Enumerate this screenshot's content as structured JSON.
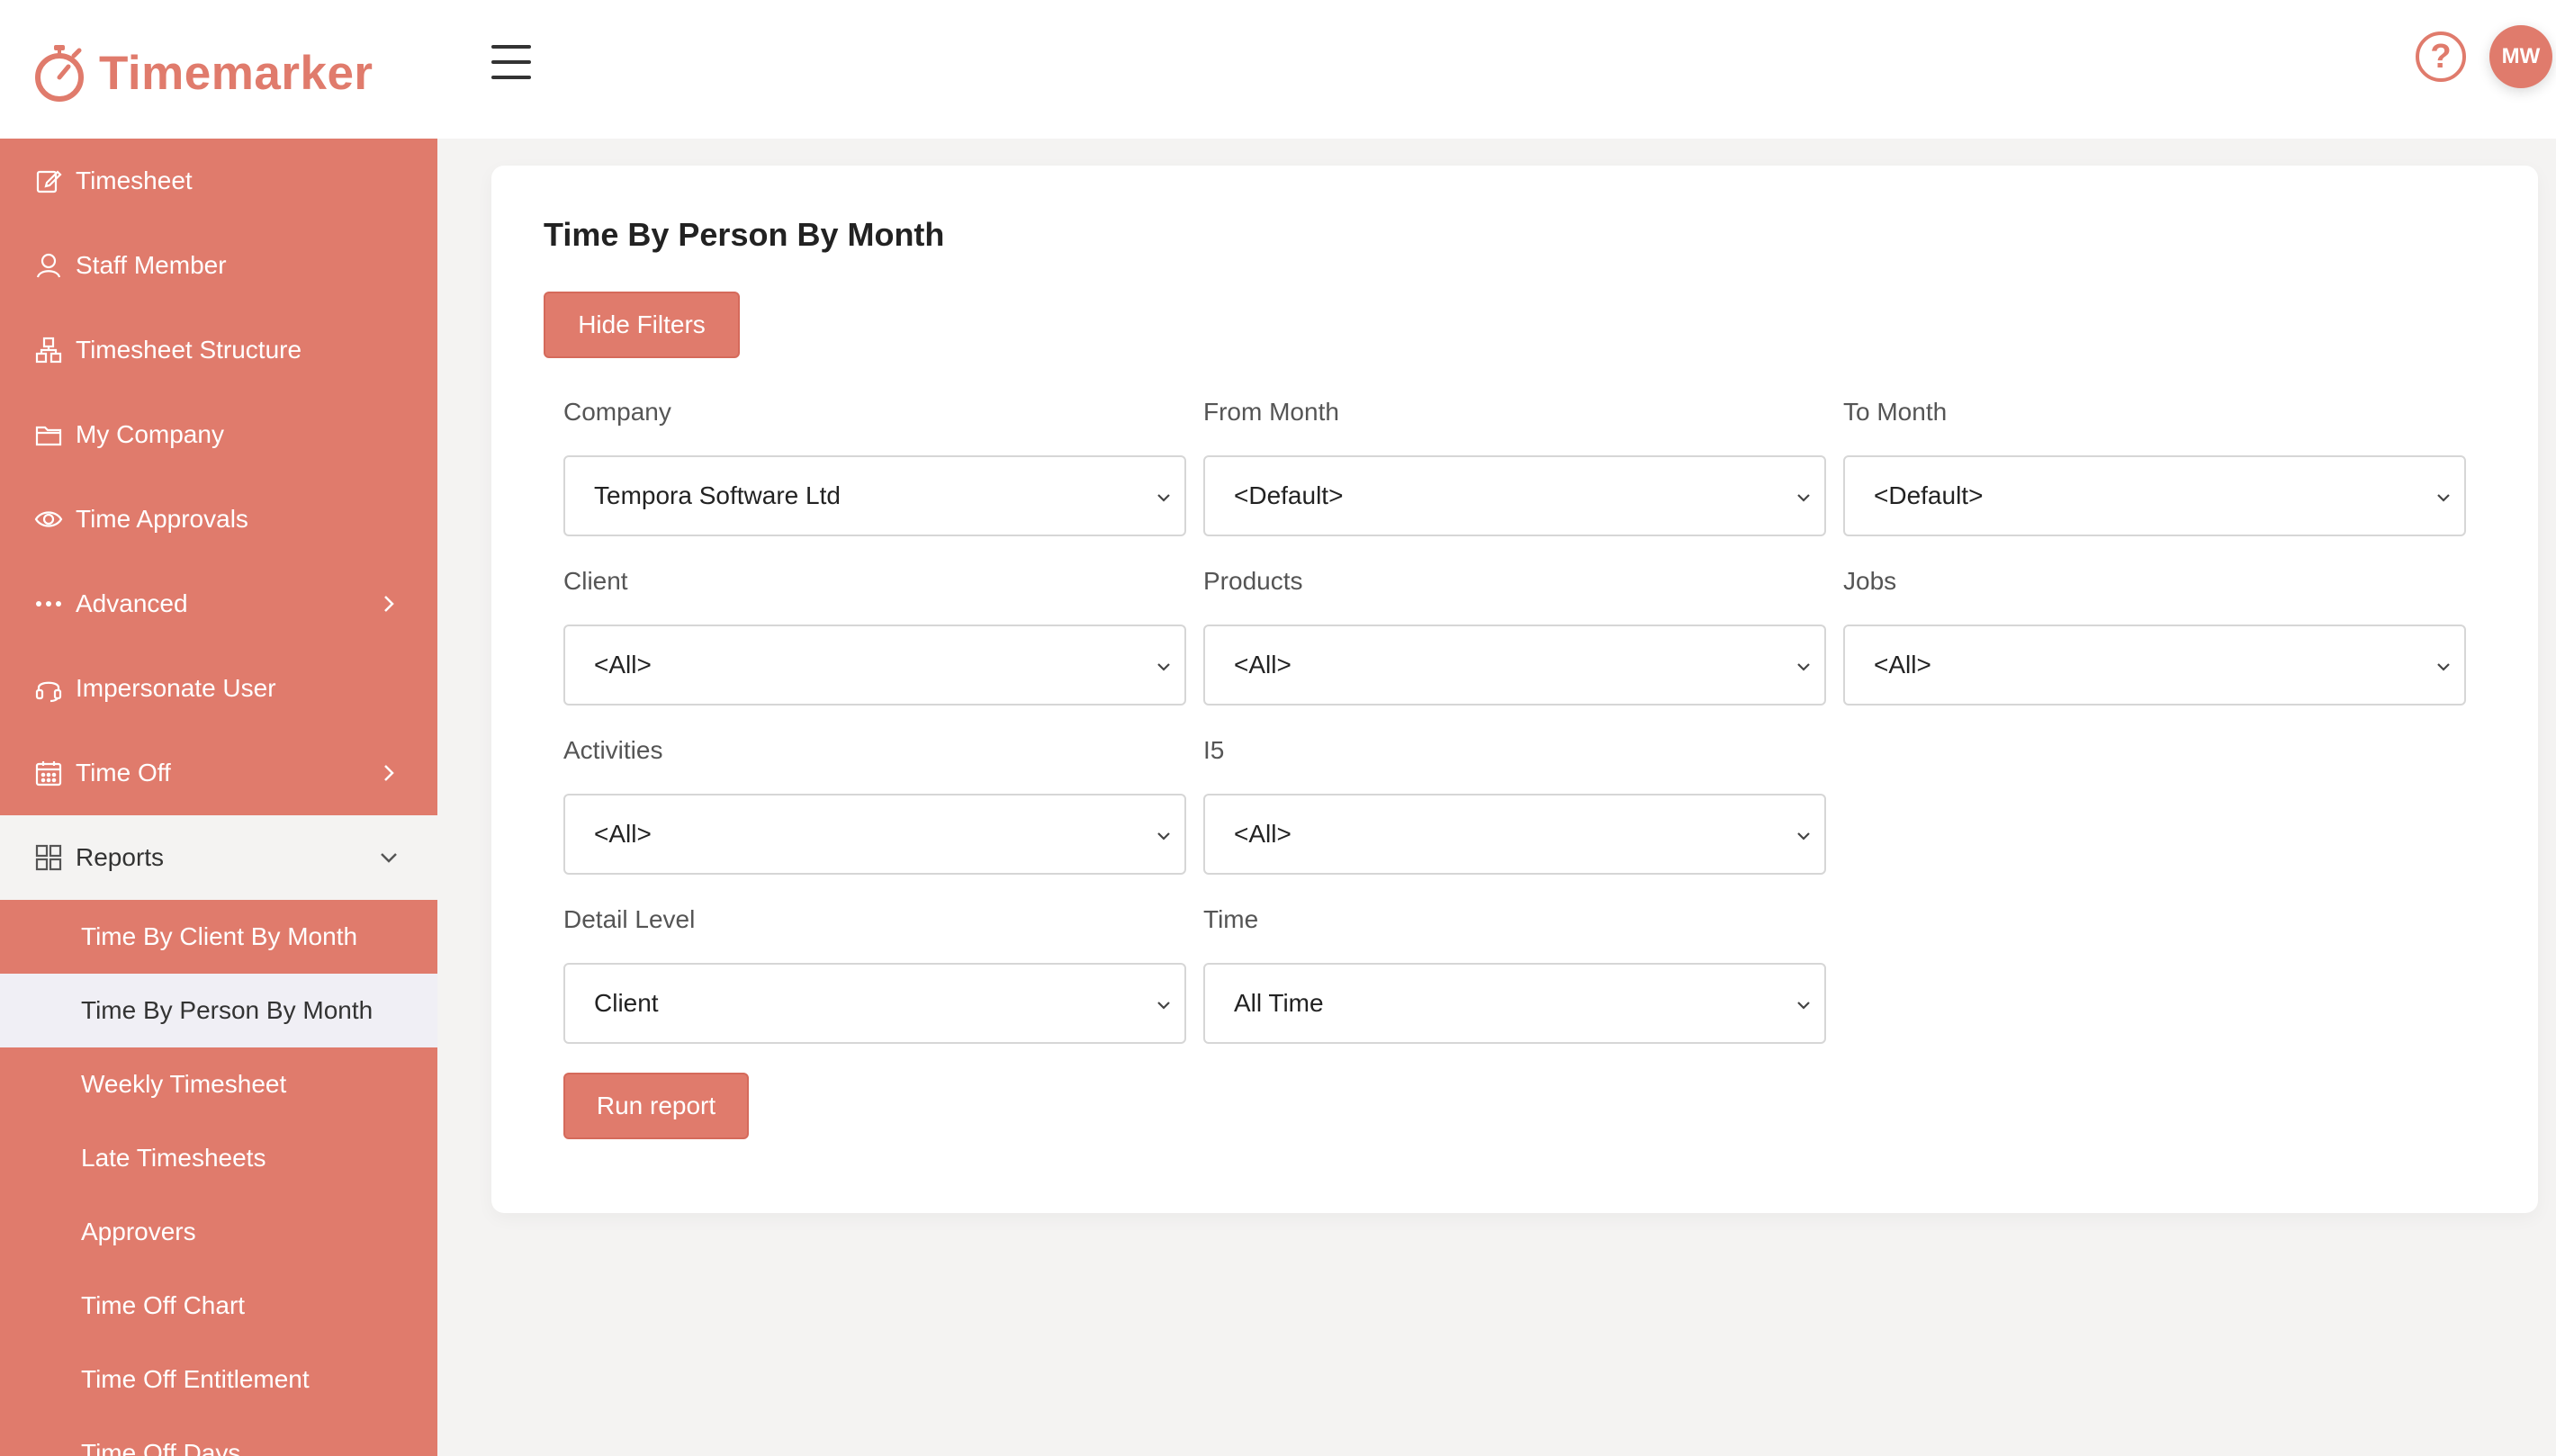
{
  "brand": {
    "name": "Timemarker",
    "accent": "#e07b6c"
  },
  "header": {
    "help_icon": "question-circle-icon",
    "avatar_initials": "MW"
  },
  "sidebar": {
    "items": [
      {
        "label": "Timesheet",
        "icon": "edit-icon"
      },
      {
        "label": "Staff Member",
        "icon": "user-icon"
      },
      {
        "label": "Timesheet Structure",
        "icon": "structure-icon"
      },
      {
        "label": "My Company",
        "icon": "folder-icon"
      },
      {
        "label": "Time Approvals",
        "icon": "eye-icon"
      },
      {
        "label": "Advanced",
        "icon": "more-dots-icon"
      },
      {
        "label": "Impersonate User",
        "icon": "headset-icon"
      },
      {
        "label": "Time Off",
        "icon": "calendar-icon"
      },
      {
        "label": "Reports",
        "icon": "grid-icon"
      }
    ],
    "report_items": [
      {
        "label": "Time By Client By Month"
      },
      {
        "label": "Time By Person By Month"
      },
      {
        "label": "Weekly Timesheet"
      },
      {
        "label": "Late Timesheets"
      },
      {
        "label": "Approvers"
      },
      {
        "label": "Time Off Chart"
      },
      {
        "label": "Time Off Entitlement"
      },
      {
        "label": "Time Off Days"
      }
    ]
  },
  "main": {
    "title": "Time By Person By Month",
    "hide_filters_label": "Hide Filters",
    "run_report_label": "Run report",
    "filters": {
      "company": {
        "label": "Company",
        "value": "Tempora Software Ltd"
      },
      "from_month": {
        "label": "From Month",
        "value": "<Default>"
      },
      "to_month": {
        "label": "To Month",
        "value": "<Default>"
      },
      "client": {
        "label": "Client",
        "value": "<All>"
      },
      "products": {
        "label": "Products",
        "value": "<All>"
      },
      "jobs": {
        "label": "Jobs",
        "value": "<All>"
      },
      "activities": {
        "label": "Activities",
        "value": "<All>"
      },
      "i5": {
        "label": "I5",
        "value": "<All>"
      },
      "detail_level": {
        "label": "Detail Level",
        "value": "Client"
      },
      "time": {
        "label": "Time",
        "value": "All Time"
      }
    }
  }
}
